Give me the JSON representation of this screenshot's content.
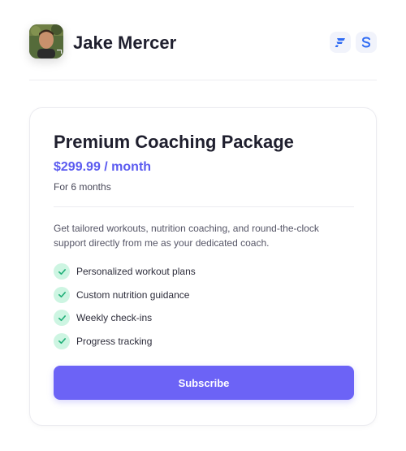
{
  "user": {
    "name": "Jake Mercer"
  },
  "header": {
    "brand_icons": [
      "f-brand-icon",
      "s-brand-icon"
    ]
  },
  "package": {
    "title": "Premium Coaching Package",
    "price": "$299.99 / month",
    "duration": "For 6 months",
    "description": "Get tailored workouts, nutrition coaching, and round-the-clock support directly from me as your dedicated coach.",
    "features": [
      "Personalized workout plans",
      "Custom nutrition guidance",
      "Weekly check-ins",
      "Progress tracking"
    ],
    "cta_label": "Subscribe"
  },
  "colors": {
    "accent": "#6c63f6",
    "price": "#5b5bf0",
    "check_bg": "#cdf5e2",
    "check_mark": "#22b07a",
    "brand_blue": "#2f6bf3"
  }
}
